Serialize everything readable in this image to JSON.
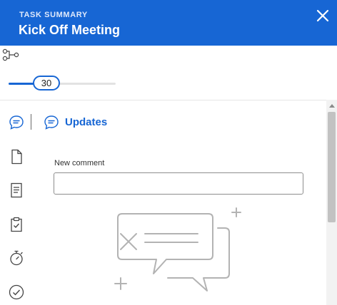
{
  "header": {
    "eyebrow": "TASK SUMMARY",
    "title": "Kick Off Meeting"
  },
  "slider": {
    "value": "30",
    "fill_fraction": 0.3
  },
  "updates": {
    "title": "Updates",
    "new_comment_label": "New comment",
    "new_comment_value": ""
  },
  "icons": {
    "close": "close-icon",
    "workflow": "workflow-icon",
    "comments": "chat-bubble-icon",
    "document": "document-icon",
    "notes": "notes-icon",
    "checklist": "clipboard-check-icon",
    "timer": "stopwatch-icon",
    "approvals": "check-circle-icon",
    "empty_state": "empty-chat-illustration"
  },
  "colors": {
    "accent": "#1766d4",
    "header_bg": "#1766d4"
  }
}
